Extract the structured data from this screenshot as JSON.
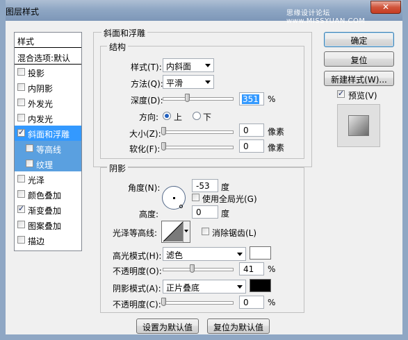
{
  "window": {
    "title": "图层样式",
    "watermark": "思缘设计论坛 www.MISSYUAN.COM",
    "close_glyph": "✕"
  },
  "styles_list": {
    "header": "样式",
    "blend_options": "混合选项:默认",
    "items": [
      {
        "label": "投影",
        "checked": false
      },
      {
        "label": "内阴影",
        "checked": false
      },
      {
        "label": "外发光",
        "checked": false
      },
      {
        "label": "内发光",
        "checked": false
      },
      {
        "label": "斜面和浮雕",
        "checked": true,
        "selected": true
      },
      {
        "label": "等高线",
        "checked": false,
        "sub": true
      },
      {
        "label": "纹理",
        "checked": false,
        "sub": true
      },
      {
        "label": "光泽",
        "checked": false
      },
      {
        "label": "颜色叠加",
        "checked": false
      },
      {
        "label": "渐变叠加",
        "checked": true
      },
      {
        "label": "图案叠加",
        "checked": false
      },
      {
        "label": "描边",
        "checked": false
      }
    ]
  },
  "bevel": {
    "group_title": "斜面和浮雕",
    "structure_title": "结构",
    "style_label": "样式(T):",
    "style_value": "内斜面",
    "technique_label": "方法(Q):",
    "technique_value": "平滑",
    "depth_label": "深度(D):",
    "depth_value": "351",
    "depth_unit": "%",
    "direction_label": "方向:",
    "direction_up": "上",
    "direction_down": "下",
    "size_label": "大小(Z):",
    "size_value": "0",
    "size_unit": "像素",
    "soften_label": "软化(F):",
    "soften_value": "0",
    "soften_unit": "像素"
  },
  "shading": {
    "group_title": "阴影",
    "angle_label": "角度(N):",
    "angle_value": "-53",
    "angle_unit": "度",
    "global_light_label": "使用全局光(G)",
    "altitude_label": "高度:",
    "altitude_value": "0",
    "altitude_unit": "度",
    "gloss_contour_label": "光泽等高线:",
    "anti_alias_label": "消除锯齿(L)",
    "highlight_mode_label": "高光模式(H):",
    "highlight_mode_value": "滤色",
    "highlight_color": "#ffffff",
    "highlight_opacity_label": "不透明度(O):",
    "highlight_opacity_value": "41",
    "highlight_opacity_unit": "%",
    "shadow_mode_label": "阴影模式(A):",
    "shadow_mode_value": "正片叠底",
    "shadow_color": "#000000",
    "shadow_opacity_label": "不透明度(C):",
    "shadow_opacity_value": "0",
    "shadow_opacity_unit": "%"
  },
  "footer": {
    "make_default": "设置为默认值",
    "reset_default": "复位为默认值"
  },
  "side_buttons": {
    "ok": "确定",
    "reset": "复位",
    "new_style": "新建样式(W)...",
    "preview_label": "预览(V)"
  }
}
